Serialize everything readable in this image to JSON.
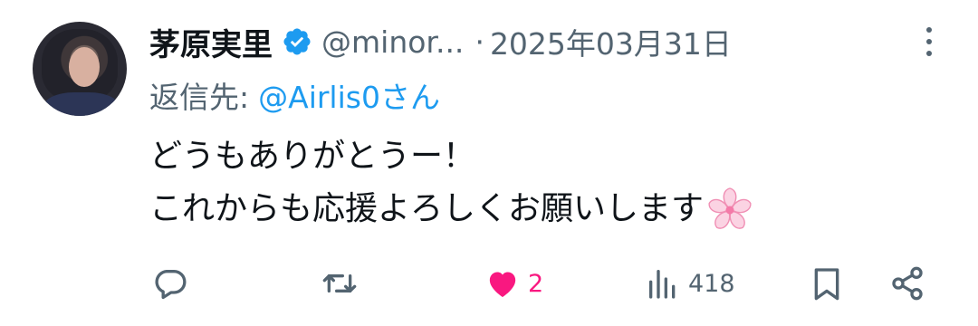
{
  "tweet": {
    "author_name": "茅原実里",
    "verified": true,
    "handle": "@minor...",
    "separator": "·",
    "date": "2025年03月31日",
    "reply_prefix": "返信先:",
    "reply_target": "@Airlis0さん",
    "lines": [
      "どうもありがとうー！",
      "これからも応援よろしくお願いします"
    ],
    "trailing_emoji": "cherry-blossom-emoji"
  },
  "actions": {
    "reply": {
      "icon": "reply-icon",
      "count": ""
    },
    "retweet": {
      "icon": "retweet-icon",
      "count": ""
    },
    "like": {
      "icon": "heart-icon",
      "count": "2",
      "active": true
    },
    "views": {
      "icon": "views-icon",
      "count": "418"
    },
    "bookmark": {
      "icon": "bookmark-icon"
    },
    "share": {
      "icon": "share-icon"
    }
  },
  "colors": {
    "text": "#0f1419",
    "secondary": "#536471",
    "link": "#1d9bf0",
    "like": "#f91880",
    "verified": "#1d9bf0"
  }
}
